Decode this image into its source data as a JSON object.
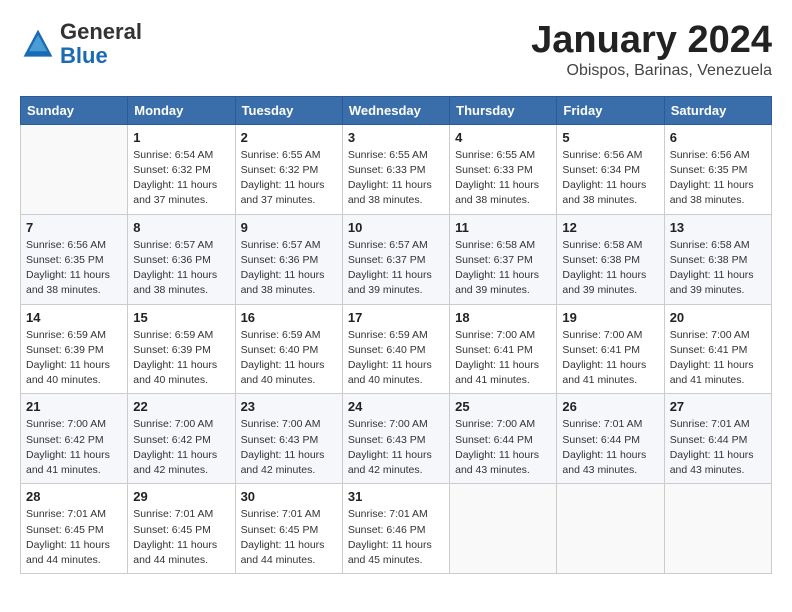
{
  "header": {
    "logo_general": "General",
    "logo_blue": "Blue",
    "month_title": "January 2024",
    "location": "Obispos, Barinas, Venezuela"
  },
  "days_of_week": [
    "Sunday",
    "Monday",
    "Tuesday",
    "Wednesday",
    "Thursday",
    "Friday",
    "Saturday"
  ],
  "weeks": [
    [
      {
        "day": "",
        "info": ""
      },
      {
        "day": "1",
        "info": "Sunrise: 6:54 AM\nSunset: 6:32 PM\nDaylight: 11 hours\nand 37 minutes."
      },
      {
        "day": "2",
        "info": "Sunrise: 6:55 AM\nSunset: 6:32 PM\nDaylight: 11 hours\nand 37 minutes."
      },
      {
        "day": "3",
        "info": "Sunrise: 6:55 AM\nSunset: 6:33 PM\nDaylight: 11 hours\nand 38 minutes."
      },
      {
        "day": "4",
        "info": "Sunrise: 6:55 AM\nSunset: 6:33 PM\nDaylight: 11 hours\nand 38 minutes."
      },
      {
        "day": "5",
        "info": "Sunrise: 6:56 AM\nSunset: 6:34 PM\nDaylight: 11 hours\nand 38 minutes."
      },
      {
        "day": "6",
        "info": "Sunrise: 6:56 AM\nSunset: 6:35 PM\nDaylight: 11 hours\nand 38 minutes."
      }
    ],
    [
      {
        "day": "7",
        "info": "Sunrise: 6:56 AM\nSunset: 6:35 PM\nDaylight: 11 hours\nand 38 minutes."
      },
      {
        "day": "8",
        "info": "Sunrise: 6:57 AM\nSunset: 6:36 PM\nDaylight: 11 hours\nand 38 minutes."
      },
      {
        "day": "9",
        "info": "Sunrise: 6:57 AM\nSunset: 6:36 PM\nDaylight: 11 hours\nand 38 minutes."
      },
      {
        "day": "10",
        "info": "Sunrise: 6:57 AM\nSunset: 6:37 PM\nDaylight: 11 hours\nand 39 minutes."
      },
      {
        "day": "11",
        "info": "Sunrise: 6:58 AM\nSunset: 6:37 PM\nDaylight: 11 hours\nand 39 minutes."
      },
      {
        "day": "12",
        "info": "Sunrise: 6:58 AM\nSunset: 6:38 PM\nDaylight: 11 hours\nand 39 minutes."
      },
      {
        "day": "13",
        "info": "Sunrise: 6:58 AM\nSunset: 6:38 PM\nDaylight: 11 hours\nand 39 minutes."
      }
    ],
    [
      {
        "day": "14",
        "info": "Sunrise: 6:59 AM\nSunset: 6:39 PM\nDaylight: 11 hours\nand 40 minutes."
      },
      {
        "day": "15",
        "info": "Sunrise: 6:59 AM\nSunset: 6:39 PM\nDaylight: 11 hours\nand 40 minutes."
      },
      {
        "day": "16",
        "info": "Sunrise: 6:59 AM\nSunset: 6:40 PM\nDaylight: 11 hours\nand 40 minutes."
      },
      {
        "day": "17",
        "info": "Sunrise: 6:59 AM\nSunset: 6:40 PM\nDaylight: 11 hours\nand 40 minutes."
      },
      {
        "day": "18",
        "info": "Sunrise: 7:00 AM\nSunset: 6:41 PM\nDaylight: 11 hours\nand 41 minutes."
      },
      {
        "day": "19",
        "info": "Sunrise: 7:00 AM\nSunset: 6:41 PM\nDaylight: 11 hours\nand 41 minutes."
      },
      {
        "day": "20",
        "info": "Sunrise: 7:00 AM\nSunset: 6:41 PM\nDaylight: 11 hours\nand 41 minutes."
      }
    ],
    [
      {
        "day": "21",
        "info": "Sunrise: 7:00 AM\nSunset: 6:42 PM\nDaylight: 11 hours\nand 41 minutes."
      },
      {
        "day": "22",
        "info": "Sunrise: 7:00 AM\nSunset: 6:42 PM\nDaylight: 11 hours\nand 42 minutes."
      },
      {
        "day": "23",
        "info": "Sunrise: 7:00 AM\nSunset: 6:43 PM\nDaylight: 11 hours\nand 42 minutes."
      },
      {
        "day": "24",
        "info": "Sunrise: 7:00 AM\nSunset: 6:43 PM\nDaylight: 11 hours\nand 42 minutes."
      },
      {
        "day": "25",
        "info": "Sunrise: 7:00 AM\nSunset: 6:44 PM\nDaylight: 11 hours\nand 43 minutes."
      },
      {
        "day": "26",
        "info": "Sunrise: 7:01 AM\nSunset: 6:44 PM\nDaylight: 11 hours\nand 43 minutes."
      },
      {
        "day": "27",
        "info": "Sunrise: 7:01 AM\nSunset: 6:44 PM\nDaylight: 11 hours\nand 43 minutes."
      }
    ],
    [
      {
        "day": "28",
        "info": "Sunrise: 7:01 AM\nSunset: 6:45 PM\nDaylight: 11 hours\nand 44 minutes."
      },
      {
        "day": "29",
        "info": "Sunrise: 7:01 AM\nSunset: 6:45 PM\nDaylight: 11 hours\nand 44 minutes."
      },
      {
        "day": "30",
        "info": "Sunrise: 7:01 AM\nSunset: 6:45 PM\nDaylight: 11 hours\nand 44 minutes."
      },
      {
        "day": "31",
        "info": "Sunrise: 7:01 AM\nSunset: 6:46 PM\nDaylight: 11 hours\nand 45 minutes."
      },
      {
        "day": "",
        "info": ""
      },
      {
        "day": "",
        "info": ""
      },
      {
        "day": "",
        "info": ""
      }
    ]
  ]
}
